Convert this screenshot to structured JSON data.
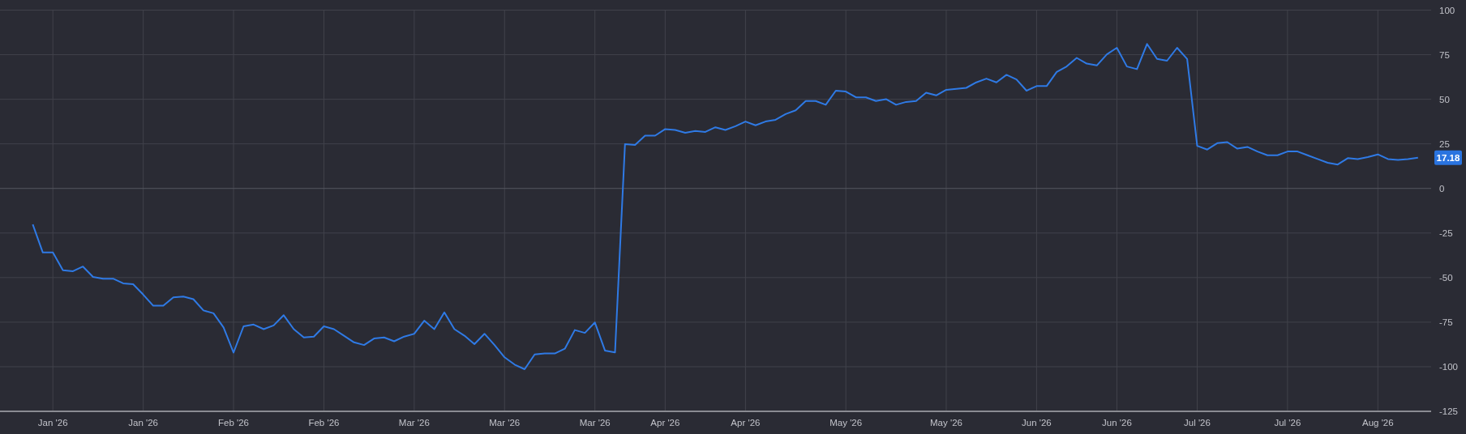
{
  "chart_data": {
    "type": "line",
    "grid": true,
    "ylim": [
      -125,
      100
    ],
    "yticks": [
      100,
      75,
      50,
      25,
      0,
      -25,
      -50,
      -75,
      -100,
      -125
    ],
    "categories": [
      null,
      null,
      "Jan '26",
      null,
      null,
      null,
      null,
      null,
      null,
      null,
      null,
      "Jan '26",
      null,
      null,
      null,
      null,
      null,
      null,
      null,
      null,
      "Feb '26",
      null,
      null,
      null,
      null,
      null,
      null,
      null,
      null,
      "Feb '26",
      null,
      null,
      null,
      null,
      null,
      null,
      null,
      null,
      "Mar '26",
      null,
      null,
      null,
      null,
      null,
      null,
      null,
      null,
      "Mar '26",
      null,
      null,
      null,
      null,
      null,
      null,
      null,
      null,
      "Mar '26",
      null,
      null,
      null,
      null,
      null,
      null,
      "Apr '26",
      null,
      null,
      null,
      null,
      null,
      null,
      null,
      "Apr '26",
      null,
      null,
      null,
      null,
      null,
      null,
      null,
      null,
      null,
      "May '26",
      null,
      null,
      null,
      null,
      null,
      null,
      null,
      null,
      null,
      "May '26",
      null,
      null,
      null,
      null,
      null,
      null,
      null,
      null,
      "Jun '26",
      null,
      null,
      null,
      null,
      null,
      null,
      null,
      "Jun '26",
      null,
      null,
      null,
      null,
      null,
      null,
      null,
      "Jul '26",
      null,
      null,
      null,
      null,
      null,
      null,
      null,
      null,
      "Jul '26",
      null,
      null,
      null,
      null,
      null,
      null,
      null,
      null,
      "Aug '26",
      null,
      null,
      null,
      null
    ],
    "series": [
      {
        "color": "#2f7ae5",
        "values": [
          -20.2,
          -35.9,
          -35.9,
          -45.9,
          -46.4,
          -43.8,
          -49.6,
          -50.6,
          -50.6,
          -53.2,
          -53.7,
          -59.5,
          -65.8,
          -65.8,
          -61.1,
          -60.6,
          -62.1,
          -68.4,
          -70,
          -77.9,
          -92.1,
          -77.3,
          -76.3,
          -78.9,
          -76.8,
          -71.1,
          -78.9,
          -83.6,
          -83.1,
          -77.3,
          -78.9,
          -82.6,
          -86.3,
          -87.8,
          -84.2,
          -83.6,
          -85.7,
          -83.1,
          -81.5,
          -74.2,
          -78.9,
          -69.5,
          -78.9,
          -82.6,
          -87.3,
          -81.5,
          -87.8,
          -94.7,
          -98.8,
          -101.4,
          -93.1,
          -92.6,
          -92.6,
          -89.9,
          -79.4,
          -81,
          -75.2,
          -90.9,
          -92,
          24.9,
          24.4,
          29.6,
          29.6,
          33.3,
          32.8,
          31.2,
          32.2,
          31.7,
          34.3,
          32.8,
          34.9,
          37.5,
          35.4,
          37.5,
          38.5,
          41.7,
          43.8,
          49,
          49,
          46.9,
          54.8,
          54.3,
          51.1,
          51.1,
          49,
          50.1,
          46.9,
          48.5,
          49,
          53.7,
          52.2,
          55.3,
          55.8,
          56.4,
          59.5,
          61.6,
          59.5,
          63.7,
          61.1,
          54.8,
          57.4,
          57.4,
          65.3,
          68.4,
          73.2,
          70,
          69,
          75.2,
          78.9,
          68.4,
          66.9,
          81,
          72.6,
          71.6,
          78.9,
          72.6,
          23.9,
          21.8,
          25.4,
          26,
          22.3,
          23.3,
          20.7,
          18.6,
          18.6,
          20.7,
          20.7,
          18.6,
          16.5,
          14.4,
          13.4,
          17,
          16.5,
          17.6,
          19.1,
          16.5,
          16,
          16.5,
          17.2
        ]
      }
    ],
    "annotations": [
      {
        "text": "17.18"
      }
    ]
  }
}
